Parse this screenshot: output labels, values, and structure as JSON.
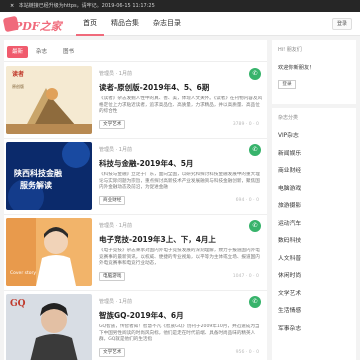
{
  "notice": {
    "close": "×",
    "text": "本站链接已经升级为https，请牢记。2019-06-15 11:17:25"
  },
  "header": {
    "logo_text": "PDF之家",
    "nav": [
      "首页",
      "精品合集",
      "杂志目录"
    ],
    "login": "登录"
  },
  "tabs": [
    "最新",
    "杂志",
    "图书"
  ],
  "articles": [
    {
      "meta": "管理员 · 1月前",
      "title": "读者-原创版-2019年4、5、6期",
      "desc": "《读者》杂志发掘人性中的真、善、美，体现人文关怀。《读者》在刊物内容及风格定位上力求贴近读者，追求高品位、高质量，力求精品，并以高质量、高品位的综合性",
      "category": "文学艺术",
      "stats": "3789 · 0 · 0",
      "thumb_text": "原创版"
    },
    {
      "meta": "管理员 · 1月前",
      "title": "科技与金融-2019年4、5月",
      "desc": "《科技与金融》立足于广东，面向全国，以研究和探讨科技金融发展中的重大理论与实际问题为宗旨，重点探讨高新技术产业发展融资与科技金融创新，聚焦国内外金融动态及前沿，为促进金融",
      "category": "商业财经",
      "stats": "694 · 0 · 0",
      "thumb_text": "陕西科技金融服务解读"
    },
    {
      "meta": "管理员 · 1月前",
      "title": "电子竞技-2019年3上、下，4月上",
      "desc": "《电子竞技》杂志秉承对国内外电子竞技发展的深刻理解，致力于报道国内外电竞赛事的最新资讯，以权威、便捷的专业视角，以平等为主体或立场、报道国内外电竞赛事和电竞行业动态，",
      "category": "电脑游戏",
      "stats": "1047 · 0 · 0",
      "thumb_text": "Cover story"
    },
    {
      "meta": "管理员 · 1月前",
      "title": "智族GQ-2019年4、6月",
      "desc": "GQ智族，传智者知！智慧不凡《智族GQ》创刊于2009年10月，并迅速成为当下中国男性阅读的时尚风向标，他们是走在时代前端、具备时尚品味的精英人群，GQ就是他们的生活指",
      "category": "文学艺术",
      "stats": "956 · 0 · 0",
      "thumb_text": "GQ"
    }
  ],
  "badge_icon": "wechat-icon",
  "sidebar": {
    "user_label": "Hi! 朋友们",
    "welcome": "欢迎你新朋友！",
    "login": "登录",
    "categories_label": "杂志分类",
    "categories": [
      "VIP杂志",
      "新闻娱乐",
      "商业财经",
      "电脑游戏",
      "旅游摄影",
      "运动汽车",
      "数码科技",
      "人文科普",
      "休闲时尚",
      "文学艺术",
      "生活情感",
      "军事杂志"
    ]
  },
  "colors": {
    "accent": "#f05b6d",
    "badge": "#37b36b"
  }
}
